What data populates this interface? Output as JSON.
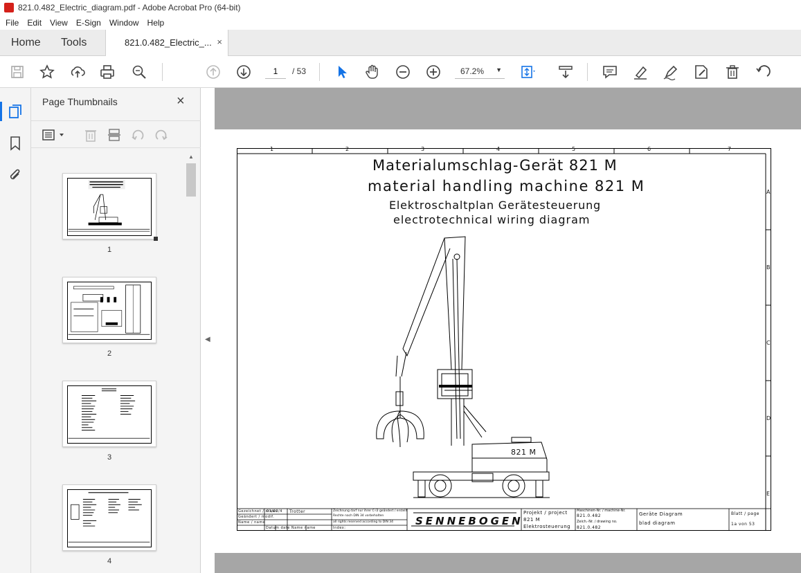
{
  "window": {
    "title": "821.0.482_Electric_diagram.pdf - Adobe Acrobat Pro (64-bit)"
  },
  "menu": [
    "File",
    "Edit",
    "View",
    "E-Sign",
    "Window",
    "Help"
  ],
  "nav": {
    "home": "Home",
    "tools": "Tools"
  },
  "tab": {
    "label": "821.0.482_Electric_...",
    "close": "×"
  },
  "toolbar": {
    "page_current": "1",
    "page_total": "/ 53",
    "zoom": "67.2%",
    "icons": [
      "save-icon",
      "star-icon",
      "upload-icon",
      "print-icon",
      "zoom-search-icon",
      "page-up-icon",
      "page-down-icon",
      "select-pointer-icon",
      "hand-icon",
      "zoom-out-icon",
      "zoom-in-icon",
      "fit-page-icon",
      "scroll-mode-icon",
      "comment-icon",
      "highlight-icon",
      "sign-icon",
      "fill-sign-icon",
      "delete-icon",
      "undo-icon"
    ]
  },
  "panel": {
    "title": "Page Thumbnails",
    "close": "×",
    "thumbnails": [
      {
        "label": "1"
      },
      {
        "label": "2"
      },
      {
        "label": "3"
      },
      {
        "label": "4"
      }
    ]
  },
  "drawing": {
    "title_de": "Materialumschlag-Gerät 821 M",
    "title_en": "material handling machine 821 M",
    "subtitle_de": "Elektroschaltplan Gerätesteuerung",
    "subtitle_en": "electrotechnical wiring diagram",
    "machine_label": "821 M",
    "cols": [
      "1",
      "2",
      "3",
      "4",
      "5",
      "6",
      "7"
    ],
    "rows": [
      "A",
      "B",
      "C",
      "D",
      "E"
    ],
    "titleblock": {
      "brand": "SENNEBOGEN",
      "gezeichnet": "Gezeichnet / drawn",
      "geaendert": "Geändert / modif.",
      "name": "Name / name",
      "date_short": "01/02/4",
      "drawer": "Trotter",
      "datum_row": "Datum  date   Name   name",
      "notice1": "Zeichnung darf nur ihrer C-i3 geändert / erstellt",
      "notice2": "Rechte nach DIN 34 vorbehalten",
      "notice3": "all rights reserved according to DIN 34",
      "index": "Index:",
      "projekt": "Projekt / project",
      "projekt_val": "821 M",
      "projekt_val2": "Elektrosteuerung",
      "maschinen": "Maschinen-Nr. / machine-Nr.",
      "maschinen_val": "821.0.482",
      "zeich": "Zeich.-Nr. / drawing no.",
      "zeich_val": "821.0.482",
      "geraete": "Geräte Diagram",
      "blatt_diag": "blad diagram",
      "blatt": "Blatt / page",
      "blatt_val": "1a  von 53"
    }
  }
}
